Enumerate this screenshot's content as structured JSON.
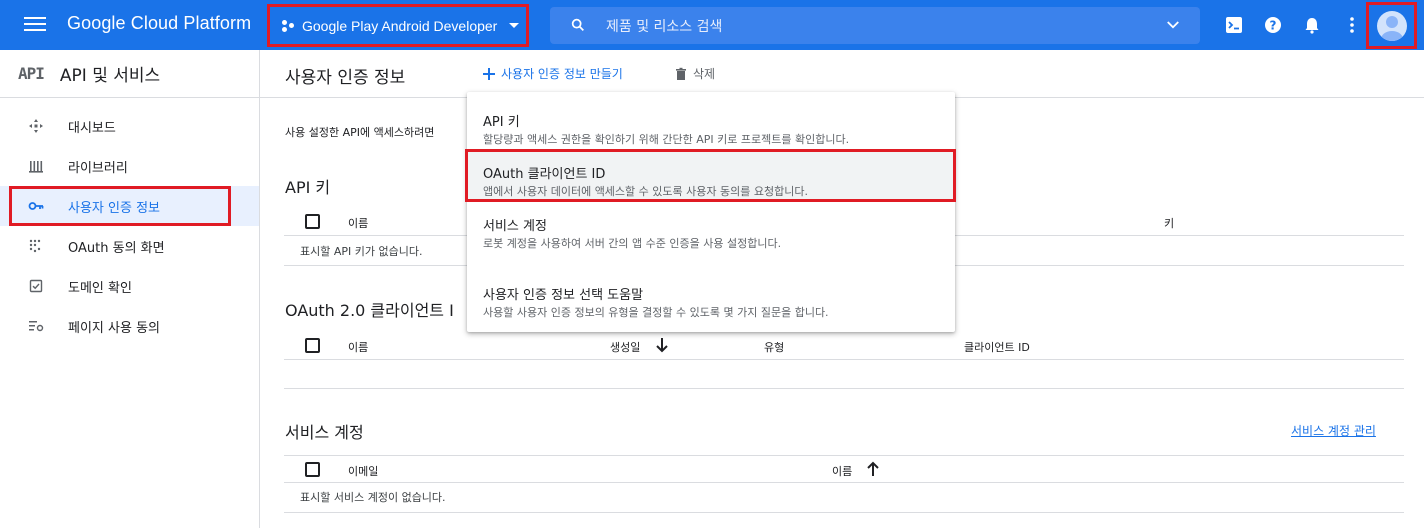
{
  "topbar": {
    "brand": "Google Cloud Platform",
    "project": "Google Play Android Developer",
    "search_placeholder": "제품 및 리소스 검색"
  },
  "sidebar": {
    "api_badge": "API",
    "title": "API 및 서비스",
    "items": [
      {
        "label": "대시보드",
        "icon": "dashboard-icon"
      },
      {
        "label": "라이브러리",
        "icon": "library-icon"
      },
      {
        "label": "사용자 인증 정보",
        "icon": "key-icon",
        "active": true
      },
      {
        "label": "OAuth 동의 화면",
        "icon": "consent-icon"
      },
      {
        "label": "도메인 확인",
        "icon": "domain-check-icon"
      },
      {
        "label": "페이지 사용 동의",
        "icon": "page-usage-icon"
      }
    ]
  },
  "main": {
    "title": "사용자 인증 정보",
    "create_label": "사용자 인증 정보 만들기",
    "delete_label": "삭제",
    "description": "사용 설정한 API에 액세스하려면",
    "api_keys": {
      "title": "API 키",
      "columns": [
        "이름",
        "키"
      ],
      "empty": "표시할 API 키가 없습니다."
    },
    "oauth": {
      "title": "OAuth 2.0 클라이언트 I",
      "columns": [
        "이름",
        "생성일",
        "유형",
        "클라이언트 ID"
      ]
    },
    "service_accounts": {
      "title": "서비스 계정",
      "manage_link": "서비스 계정 관리",
      "columns": [
        "이메일",
        "이름"
      ],
      "empty": "표시할 서비스 계정이 없습니다."
    }
  },
  "dropdown": {
    "items": [
      {
        "label": "API 키",
        "desc": "할당량과 액세스 권한을 확인하기 위해 간단한 API 키로 프로젝트를 확인합니다."
      },
      {
        "label": "OAuth 클라이언트 ID",
        "desc": "앱에서 사용자 데이터에 액세스할 수 있도록 사용자 동의를 요청합니다."
      },
      {
        "label": "서비스 계정",
        "desc": "로봇 계정을 사용하여 서버 간의 앱 수준 인증을 사용 설정합니다."
      },
      {
        "label": "사용자 인증 정보 선택 도움말",
        "desc": "사용할 사용자 인증 정보의 유형을 결정할 수 있도록 몇 가지 질문을 합니다."
      }
    ]
  },
  "colors": {
    "accent": "#1a73e8",
    "highlight": "#e01b24"
  }
}
